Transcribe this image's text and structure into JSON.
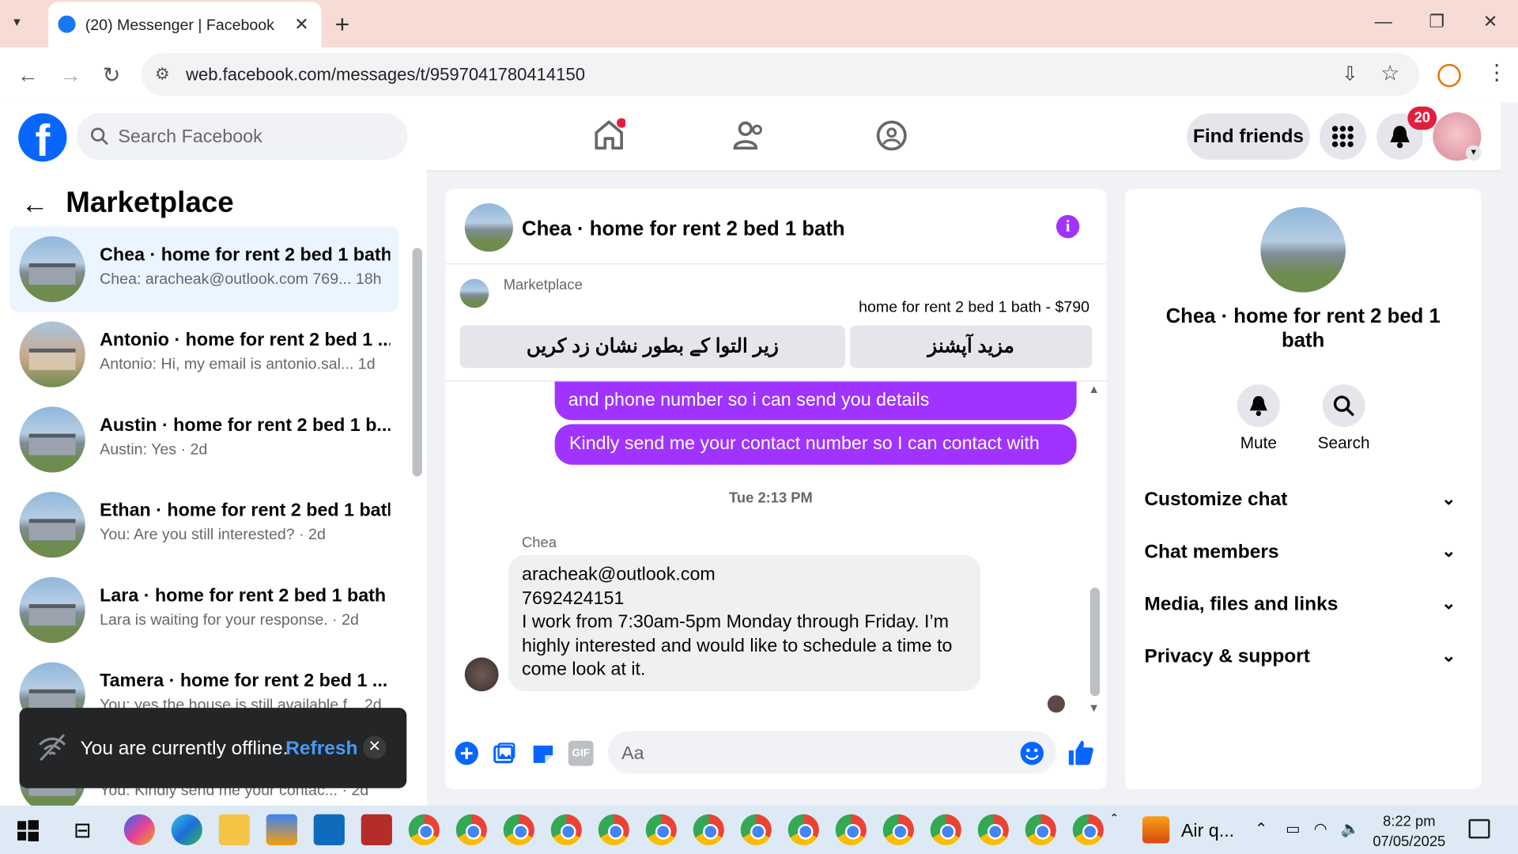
{
  "browser": {
    "tab_title": "(20) Messenger | Facebook",
    "url": "web.facebook.com/messages/t/9597041780414150"
  },
  "header": {
    "search_placeholder": "Search Facebook",
    "find_friends": "Find friends",
    "notif_count": "20",
    "logo": "f"
  },
  "left": {
    "title": "Marketplace",
    "conversations": [
      {
        "name": "Chea · home for rent 2 bed 1 bath",
        "preview": "Chea: aracheak@outlook.com 769... 18h"
      },
      {
        "name": "Antonio · home for rent 2 bed 1 ...",
        "preview": "Antonio: Hi, my email is antonio.sal... 1d"
      },
      {
        "name": "Austin · home for rent 2 bed 1 b...",
        "preview": "Austin: Yes · 2d"
      },
      {
        "name": "Ethan · home for rent 2 bed 1 bath",
        "preview": "You: Are you still interested? · 2d"
      },
      {
        "name": "Lara · home for rent 2 bed 1 bath",
        "preview": "Lara is waiting for your response. · 2d"
      },
      {
        "name": "Tamera · home for rent 2 bed 1 ...",
        "preview": "You: yes the house is still available f... 2d"
      },
      {
        "name": "",
        "preview": "You: Kindly send me your contac... · 2d"
      }
    ]
  },
  "toast": {
    "text": "You are currently offline.",
    "refresh": "Refresh",
    "close": "✕"
  },
  "chat": {
    "title": "Chea · home for rent 2 bed 1 bath",
    "info": "i",
    "marketplace_label": "Marketplace",
    "listing": "home for rent 2 bed 1 bath - $790",
    "btn_pending": "زیر التوا کے بطور نشان زد کریں",
    "btn_more": "مزید آپشنز",
    "msg1": "and phone number so i can send you details",
    "msg2": "Kindly send me your contact number so I can contact with you.",
    "timestamp": "Tue 2:13 PM",
    "sender": "Chea",
    "msg3_lines": [
      "aracheak@outlook.com",
      "7692424151",
      "I work from 7:30am-5pm Monday through Friday. I’m",
      "highly interested and would like to schedule a time to",
      "come look at it."
    ],
    "composer_placeholder": "Aa"
  },
  "right": {
    "title": "Chea · home for rent 2 bed 1 bath",
    "mute": "Mute",
    "search": "Search",
    "sections": [
      "Customize chat",
      "Chat members",
      "Media, files and links",
      "Privacy & support"
    ]
  },
  "taskbar": {
    "air": "Air q...",
    "time": "8:22 pm",
    "date": "07/05/2025"
  },
  "colors": {
    "accent": "#a033ff",
    "fb_blue": "#0866ff",
    "notif_red": "#e41e3f"
  }
}
